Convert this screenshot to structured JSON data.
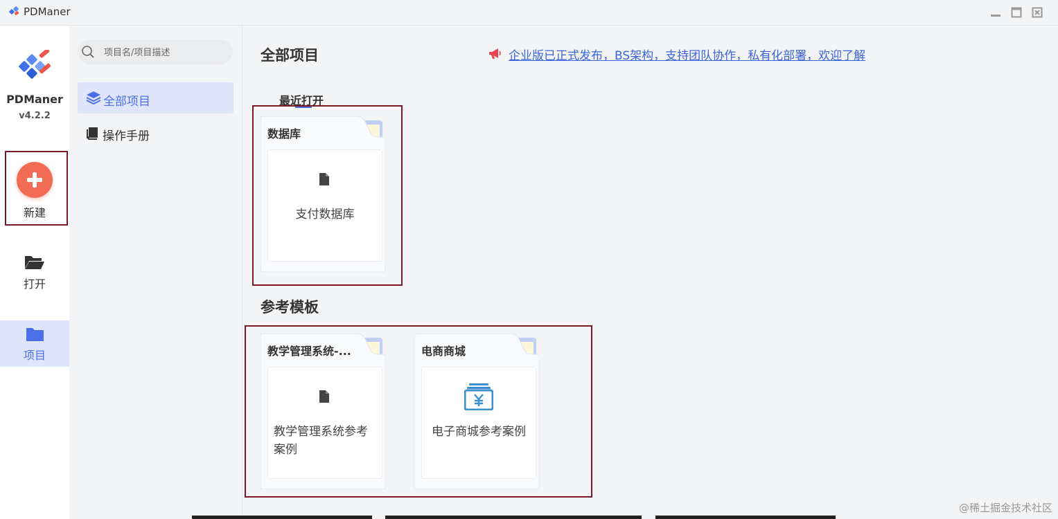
{
  "window": {
    "title": "PDManer",
    "controls": [
      "minimize-icon",
      "maximize-icon",
      "close-icon"
    ]
  },
  "rail": {
    "brand_name": "PDManer",
    "version": "v4.2.2",
    "items": [
      {
        "label": "新建",
        "icon": "plus-icon"
      },
      {
        "label": "打开",
        "icon": "folder-open-icon"
      },
      {
        "label": "项目",
        "icon": "folder-icon",
        "active": true
      }
    ]
  },
  "nav": {
    "search_placeholder": "项目名/项目描述",
    "items": [
      {
        "label": "全部项目",
        "icon": "layers-icon",
        "active": true
      },
      {
        "label": "操作手册",
        "icon": "book-icon"
      }
    ]
  },
  "main": {
    "title": "全部项目",
    "announcement": "企业版已正式发布，BS架构，支持团队协作，私有化部署，欢迎了解",
    "recent": {
      "title": "最近打开",
      "cards": [
        {
          "title": "数据库",
          "description": "支付数据库",
          "icon": "file-icon"
        }
      ]
    },
    "templates": {
      "title": "参考模板",
      "cards": [
        {
          "title": "教学管理系统-...",
          "description": "教学管理系统参考案例",
          "icon": "file-icon"
        },
        {
          "title": "电商商城",
          "description": "电子商城参考案例",
          "icon": "yuan-register-icon"
        }
      ]
    }
  },
  "watermark": "@稀土掘金技术社区",
  "colors": {
    "accent": "#4b6fe6",
    "link": "#3b64d8",
    "new_button": "#f26b55",
    "active_bg": "#dfe6fb",
    "highlight_box": "#7a1827",
    "megaphone": "#e8434e"
  }
}
